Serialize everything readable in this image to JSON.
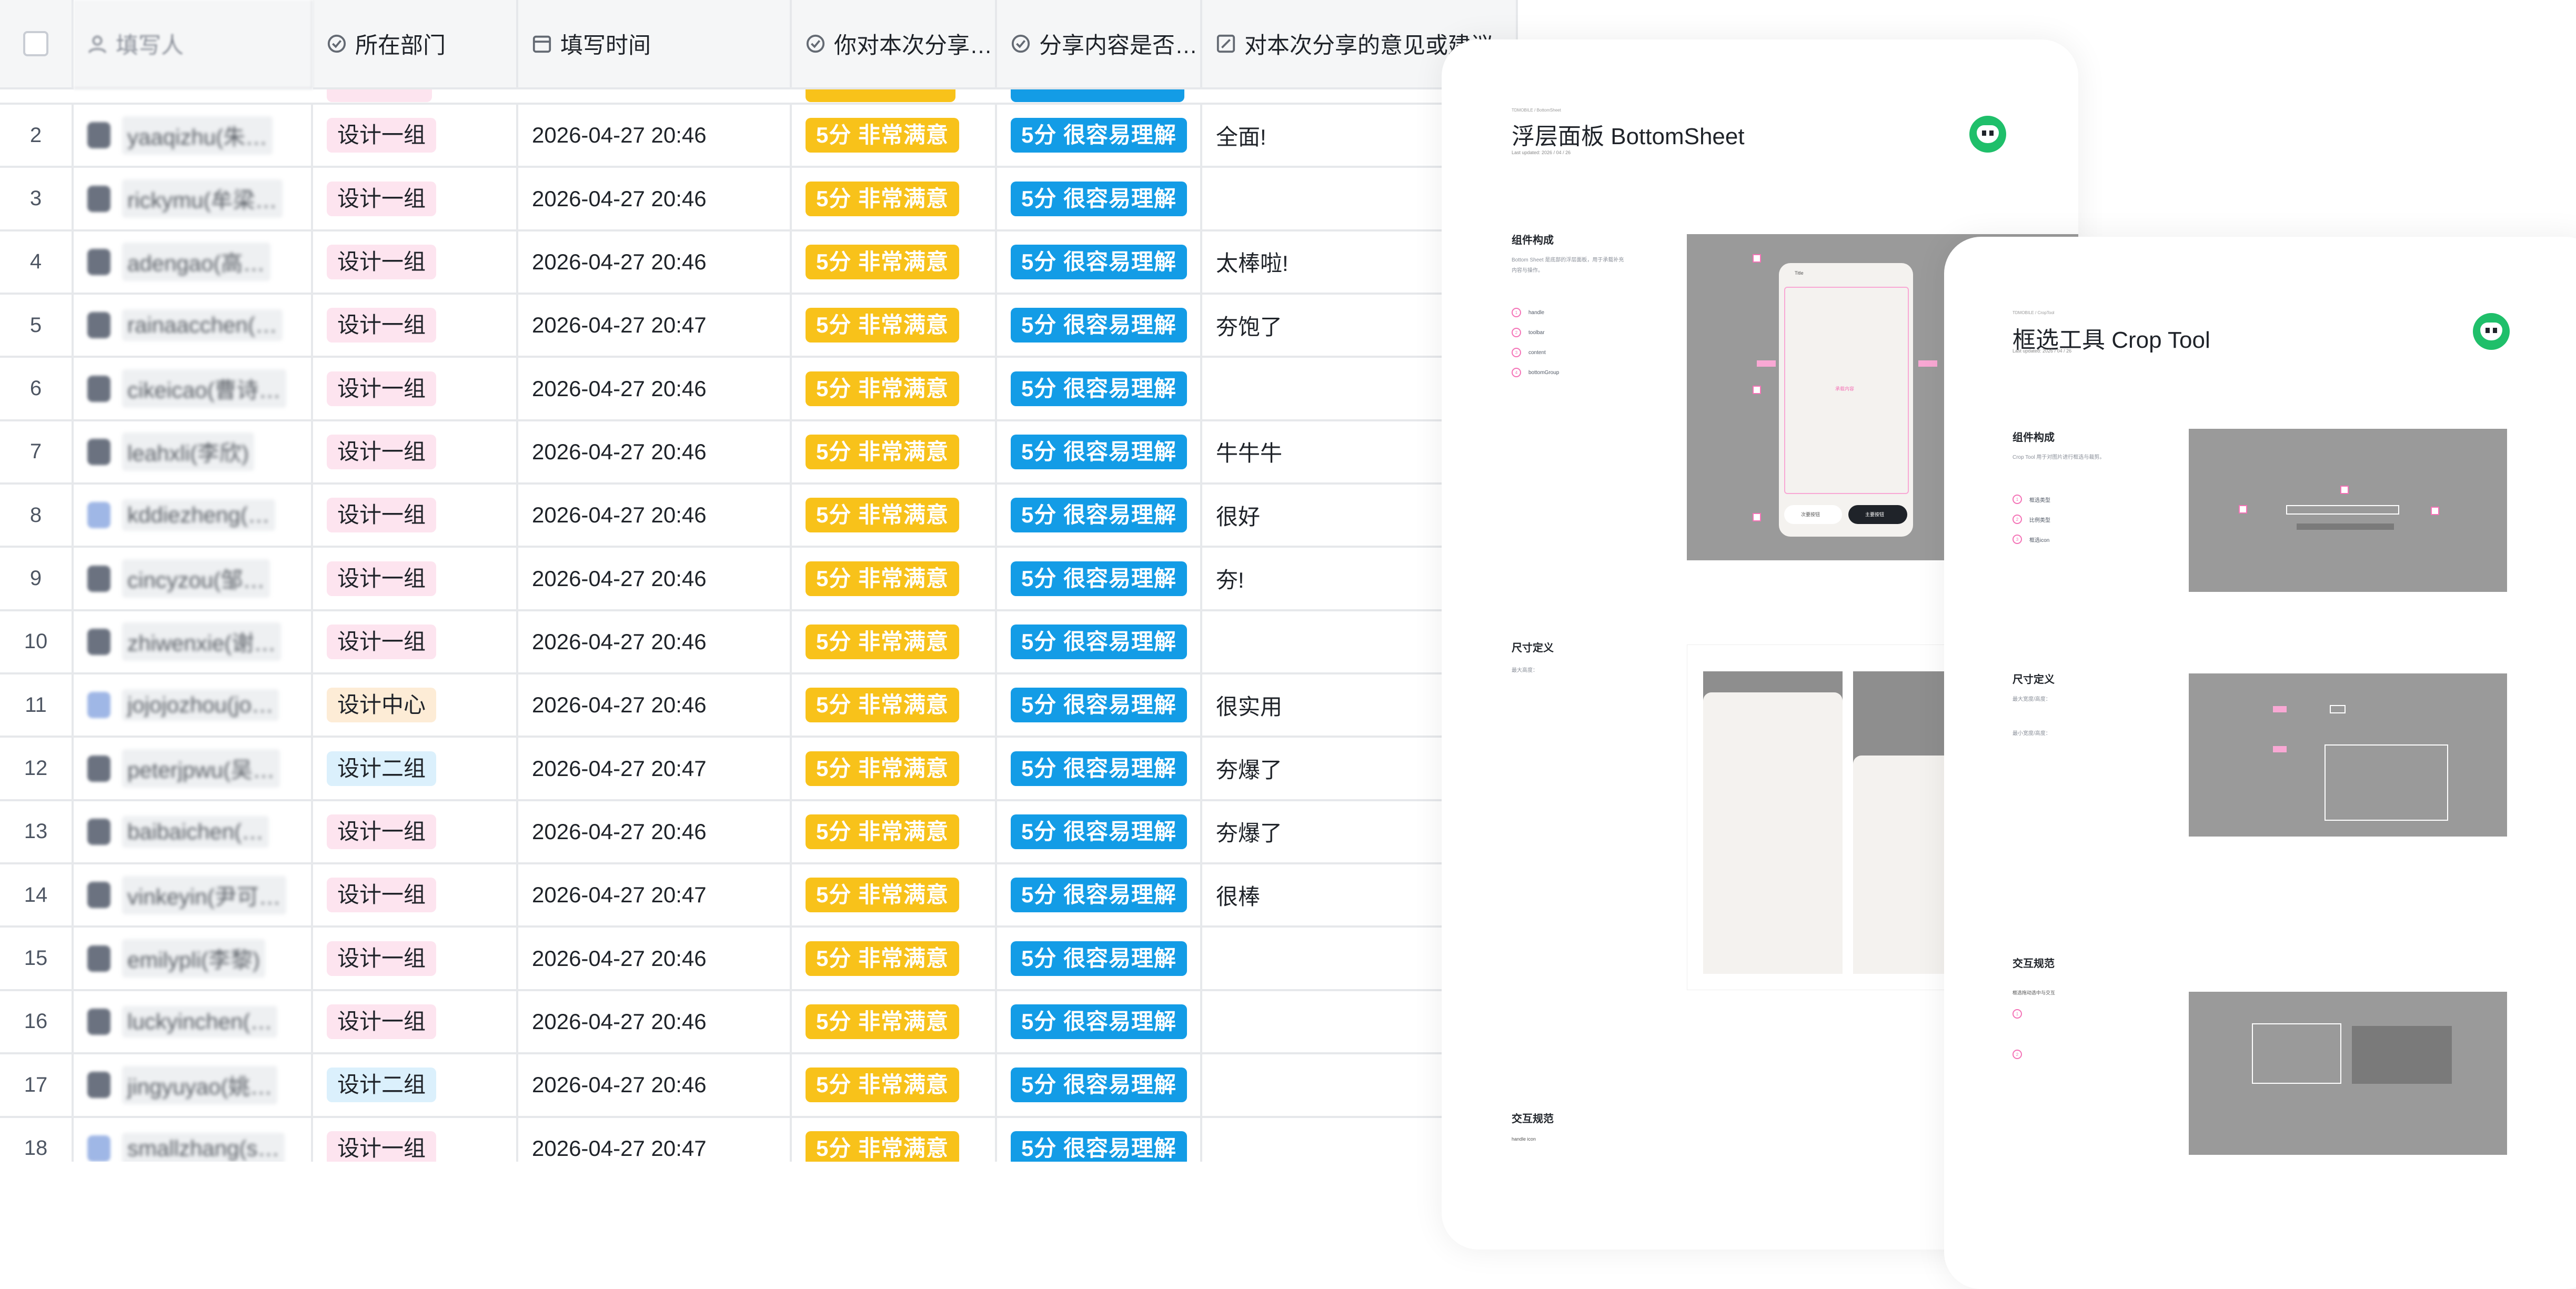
{
  "sheet": {
    "headers": {
      "filler": "填写人",
      "dept": "所在部门",
      "time": "填写时间",
      "satisfaction": "你对本次分享…",
      "understand": "分享内容是否…",
      "comments": "对本次分享的意见或建议"
    },
    "rows": [
      {
        "idx": "2",
        "name": "yaaqizhu(朱…",
        "dept": "设计一组",
        "dept_color": "pink",
        "time": "2026-04-27 20:46",
        "sat": "5分 非常满意",
        "und": "5分 很容易理解",
        "comment": "全面!"
      },
      {
        "idx": "3",
        "name": "rickymu(牟梁…",
        "dept": "设计一组",
        "dept_color": "pink",
        "time": "2026-04-27 20:46",
        "sat": "5分 非常满意",
        "und": "5分 很容易理解",
        "comment": ""
      },
      {
        "idx": "4",
        "name": "adengao(高…",
        "dept": "设计一组",
        "dept_color": "pink",
        "time": "2026-04-27 20:46",
        "sat": "5分 非常满意",
        "und": "5分 很容易理解",
        "comment": "太棒啦!"
      },
      {
        "idx": "5",
        "name": "rainaacchen(…",
        "dept": "设计一组",
        "dept_color": "pink",
        "time": "2026-04-27 20:47",
        "sat": "5分 非常满意",
        "und": "5分 很容易理解",
        "comment": "夯饱了"
      },
      {
        "idx": "6",
        "name": "cikeicao(曹诗…",
        "dept": "设计一组",
        "dept_color": "pink",
        "time": "2026-04-27 20:46",
        "sat": "5分 非常满意",
        "und": "5分 很容易理解",
        "comment": ""
      },
      {
        "idx": "7",
        "name": "leahxli(李欣)",
        "dept": "设计一组",
        "dept_color": "pink",
        "time": "2026-04-27 20:46",
        "sat": "5分 非常满意",
        "und": "5分 很容易理解",
        "comment": "牛牛牛"
      },
      {
        "idx": "8",
        "name": "kddiezheng(…",
        "dept": "设计一组",
        "dept_color": "pink",
        "time": "2026-04-27 20:46",
        "sat": "5分 非常满意",
        "und": "5分 很容易理解",
        "comment": "很好"
      },
      {
        "idx": "9",
        "name": "cincyzou(邹…",
        "dept": "设计一组",
        "dept_color": "pink",
        "time": "2026-04-27 20:46",
        "sat": "5分 非常满意",
        "und": "5分 很容易理解",
        "comment": "夯!"
      },
      {
        "idx": "10",
        "name": "zhiwenxie(谢…",
        "dept": "设计一组",
        "dept_color": "pink",
        "time": "2026-04-27 20:46",
        "sat": "5分 非常满意",
        "und": "5分 很容易理解",
        "comment": ""
      },
      {
        "idx": "11",
        "name": "jojojozhou(jo…",
        "dept": "设计中心",
        "dept_color": "orange",
        "time": "2026-04-27 20:46",
        "sat": "5分 非常满意",
        "und": "5分 很容易理解",
        "comment": "很实用"
      },
      {
        "idx": "12",
        "name": "peterjpwu(吴…",
        "dept": "设计二组",
        "dept_color": "blue",
        "time": "2026-04-27 20:47",
        "sat": "5分 非常满意",
        "und": "5分 很容易理解",
        "comment": "夯爆了"
      },
      {
        "idx": "13",
        "name": "baibaichen(…",
        "dept": "设计一组",
        "dept_color": "pink",
        "time": "2026-04-27 20:46",
        "sat": "5分 非常满意",
        "und": "5分 很容易理解",
        "comment": "夯爆了"
      },
      {
        "idx": "14",
        "name": "vinkeyin(尹可…",
        "dept": "设计一组",
        "dept_color": "pink",
        "time": "2026-04-27 20:47",
        "sat": "5分 非常满意",
        "und": "5分 很容易理解",
        "comment": "很棒"
      },
      {
        "idx": "15",
        "name": "emilypli(李黎)",
        "dept": "设计一组",
        "dept_color": "pink",
        "time": "2026-04-27 20:46",
        "sat": "5分 非常满意",
        "und": "5分 很容易理解",
        "comment": ""
      },
      {
        "idx": "16",
        "name": "luckyinchen(…",
        "dept": "设计一组",
        "dept_color": "pink",
        "time": "2026-04-27 20:46",
        "sat": "5分 非常满意",
        "und": "5分 很容易理解",
        "comment": ""
      },
      {
        "idx": "17",
        "name": "jingyuyao(姚…",
        "dept": "设计二组",
        "dept_color": "blue",
        "time": "2026-04-27 20:46",
        "sat": "5分 非常满意",
        "und": "5分 很容易理解",
        "comment": ""
      },
      {
        "idx": "18",
        "name": "smallzhang(s…",
        "dept": "设计一组",
        "dept_color": "pink",
        "time": "2026-04-27 20:47",
        "sat": "5分 非常满意",
        "und": "5分 很容易理解",
        "comment": ""
      }
    ]
  },
  "bottom_sheet_doc": {
    "breadcrumb": "TDMOBILE / BottomSheet",
    "title": "浮层面板 BottomSheet",
    "updated": "Last updated: 2026 / 04 / 26",
    "sec_compose": "组件构成",
    "compose_text": "Bottom Sheet 是底部的浮层面板，用于承载补充内容与操作。",
    "legend": [
      "handle",
      "toolbar",
      "content",
      "bottomGroup"
    ],
    "phone_title": "Title",
    "phone_content": "承载内容",
    "btn_cancel": "次要按钮",
    "btn_confirm": "主要按钮",
    "sec_size": "尺寸定义",
    "size_text": "最大高度：",
    "sec_interaction": "交互规范",
    "interaction_text": "handle icon"
  },
  "crop_tool_doc": {
    "breadcrumb": "TDMOBILE / CropTool",
    "title": "框选工具 Crop Tool",
    "updated": "Last updated: 2026 / 04 / 26",
    "sec_compose": "组件构成",
    "compose_text": "Crop Tool 用于对图片进行框选与裁剪。",
    "legend": [
      "框选类型",
      "比例类型",
      "框选icon"
    ],
    "sec_size": "尺寸定义",
    "size_text_1": "最大宽度/高度：",
    "size_text_2": "最小宽度/高度：",
    "sec_interaction": "交互规范",
    "interaction_text": "框选拖动选中与交互"
  }
}
